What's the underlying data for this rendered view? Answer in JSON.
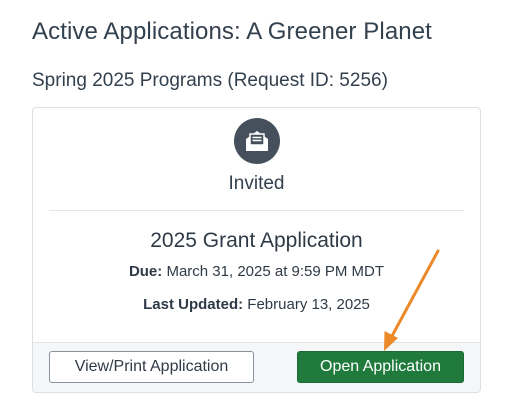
{
  "page": {
    "title": "Active Applications: A Greener Planet",
    "section_title": "Spring 2025 Programs (Request ID: 5256)"
  },
  "card": {
    "status_icon": "envelope-open-icon",
    "status_label": "Invited",
    "application_title": "2025 Grant Application",
    "due_label": "Due:",
    "due_value": "March 31, 2025 at 9:59 PM MDT",
    "updated_label": "Last Updated:",
    "updated_value": "February 13, 2025",
    "view_button_label": "View/Print Application",
    "open_button_label": "Open Application"
  },
  "annotation": {
    "arrow_icon": "arrow-annotation-icon",
    "color": "#ec8a2a"
  }
}
